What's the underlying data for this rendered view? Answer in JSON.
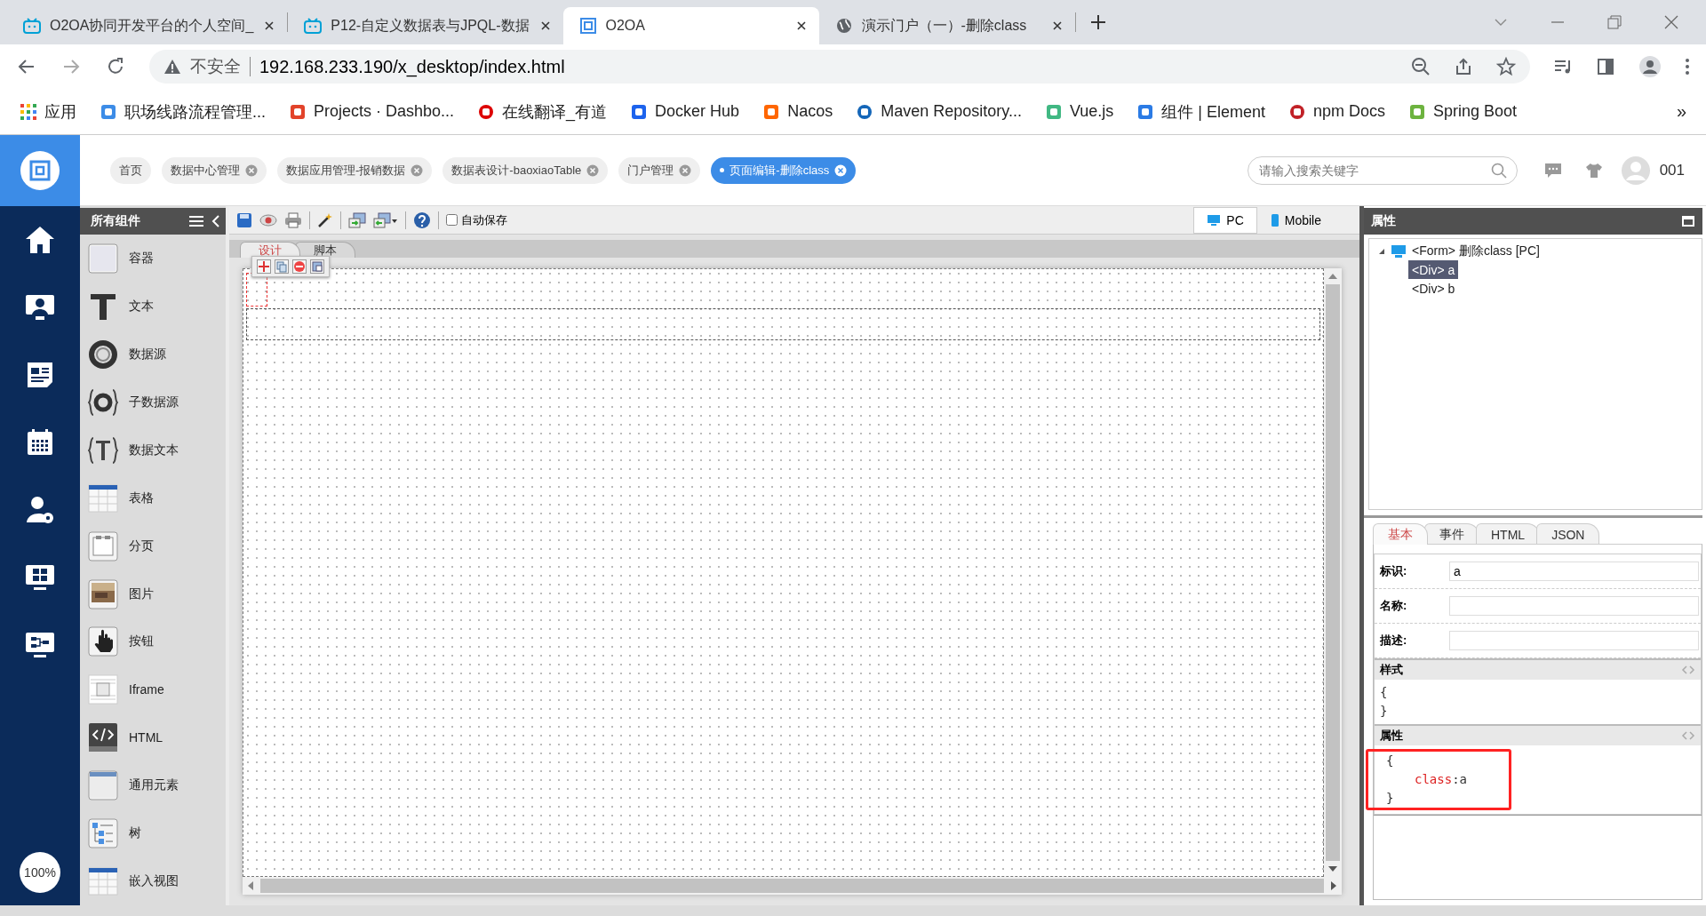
{
  "browser": {
    "tabs": [
      {
        "title": "O2OA协同开发平台的个人空间_",
        "selected": false
      },
      {
        "title": "P12-自定义数据表与JPQL-数据",
        "selected": false
      },
      {
        "title": "O2OA",
        "selected": true
      },
      {
        "title": "演示门户（一）-删除class",
        "selected": false
      }
    ],
    "address": {
      "security": "不安全",
      "url": "192.168.233.190/x_desktop/index.html"
    },
    "bookmarks": [
      "应用",
      "职场线路流程管理...",
      "Projects · Dashbo...",
      "在线翻译_有道",
      "Docker Hub",
      "Nacos",
      "Maven Repository...",
      "Vue.js",
      "组件 | Element",
      "npm Docs",
      "Spring Boot"
    ],
    "more": "»"
  },
  "app": {
    "header_tabs": [
      {
        "label": "首页",
        "closable": false,
        "selected": false
      },
      {
        "label": "数据中心管理",
        "closable": true,
        "selected": false
      },
      {
        "label": "数据应用管理-报销数据",
        "closable": true,
        "selected": false
      },
      {
        "label": "数据表设计-baoxiaoTable",
        "closable": true,
        "selected": false
      },
      {
        "label": "门户管理",
        "closable": true,
        "selected": false
      },
      {
        "label": "页面编辑-删除class",
        "closable": true,
        "selected": true
      }
    ],
    "search": {
      "placeholder": "请输入搜索关键字"
    },
    "user": "001",
    "zoom": "100%"
  },
  "palette": {
    "title": "所有组件",
    "items": [
      "容器",
      "文本",
      "数据源",
      "子数据源",
      "数据文本",
      "表格",
      "分页",
      "图片",
      "按钮",
      "Iframe",
      "HTML",
      "通用元素",
      "树",
      "嵌入视图"
    ]
  },
  "designer": {
    "autosave": {
      "label": "自动保存",
      "checked": false
    },
    "devices": [
      {
        "label": "PC",
        "selected": true
      },
      {
        "label": "Mobile",
        "selected": false
      }
    ],
    "tabs": [
      {
        "label": "设计",
        "selected": true
      },
      {
        "label": "脚本",
        "selected": false
      }
    ]
  },
  "properties": {
    "title": "属性",
    "tree": {
      "label": "<Form> 删除class [PC]",
      "expanded": true,
      "children": [
        {
          "label": "<Div> a",
          "selected": true
        },
        {
          "label": "<Div> b",
          "selected": false
        }
      ]
    },
    "tabs": [
      {
        "label": "基本",
        "selected": true
      },
      {
        "label": "事件",
        "selected": false
      },
      {
        "label": "HTML",
        "selected": false
      },
      {
        "label": "JSON",
        "selected": false
      }
    ],
    "fields": [
      {
        "label": "标识:",
        "value": "a"
      },
      {
        "label": "名称:"
      },
      {
        "label": "描述:"
      }
    ],
    "style_section": {
      "title": "样式",
      "open": "{",
      "close": "}"
    },
    "attr_section": {
      "title": "属性",
      "open": "{",
      "entries": [
        {
          "key": "class",
          "separator": ":",
          "value": "a"
        }
      ],
      "close": "}",
      "highlighted": true
    }
  }
}
